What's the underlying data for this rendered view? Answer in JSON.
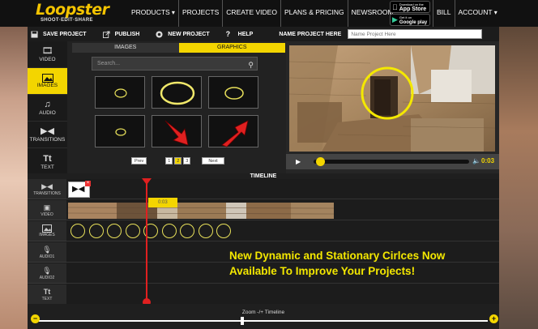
{
  "nav": {
    "brand": "Loopster",
    "tagline": "SHOOT·EDIT·SHARE",
    "items": [
      {
        "label": "PRODUCTS",
        "caret": true
      },
      {
        "label": "PROJECTS",
        "caret": false
      },
      {
        "label": "CREATE VIDEO",
        "caret": false
      },
      {
        "label": "PLANS & PRICING",
        "caret": false
      },
      {
        "label": "NEWSROOM",
        "caret": false
      }
    ],
    "appstore_small": "Download on the",
    "appstore": "App Store",
    "googleplay_small": "Get it on",
    "googleplay": "Google play",
    "user": "BILL",
    "account": "ACCOUNT"
  },
  "toolbar": {
    "save": "SAVE PROJECT",
    "publish": "PUBLISH",
    "new_project": "NEW PROJECT",
    "help": "HELP",
    "name_label": "NAME PROJECT HERE",
    "name_placeholder": "Name Project Here"
  },
  "sidebar": {
    "items": [
      {
        "label": "VIDEO",
        "icon": "film-icon",
        "active": false
      },
      {
        "label": "IMAGES",
        "icon": "image-icon",
        "active": true
      },
      {
        "label": "AUDIO",
        "icon": "music-icon",
        "active": false
      },
      {
        "label": "TRANSITIONS",
        "icon": "transition-icon",
        "active": false
      },
      {
        "label": "TEXT",
        "icon": "text-icon",
        "active": false
      }
    ]
  },
  "panel": {
    "tabs": [
      {
        "label": "IMAGES",
        "active": false
      },
      {
        "label": "GRAPHICS",
        "active": true
      }
    ],
    "search_placeholder": "Search...",
    "pager": {
      "prev": "Prev",
      "next": "Next",
      "pages": [
        "1",
        "2",
        "3"
      ],
      "current": "2"
    }
  },
  "preview": {
    "time": "0:03",
    "progress": 0.01
  },
  "timeline": {
    "title": "TIMELINE",
    "tracks": [
      {
        "label": "TRANSITIONS",
        "icon": "transition-icon"
      },
      {
        "label": "VIDEO",
        "icon": "video-camera-icon"
      },
      {
        "label": "IMAGES",
        "icon": "image-icon"
      },
      {
        "label": "AUDIO1",
        "icon": "microphone-icon"
      },
      {
        "label": "AUDIO2",
        "icon": "microphone-icon"
      },
      {
        "label": "TEXT",
        "icon": "text-icon"
      }
    ],
    "playhead_time": "0:03",
    "circle_clips": 9
  },
  "announcement": {
    "line1": "New Dynamic and Stationary Cirlces Now",
    "line2": "Available To Improve Your Projects!"
  },
  "zoom": {
    "label": "Zoom -/+ Timeline",
    "minus": "−",
    "plus": "+",
    "level": 0.45
  },
  "colors": {
    "accent": "#f3d500",
    "playhead": "#e02020",
    "announce": "#f4e800"
  }
}
